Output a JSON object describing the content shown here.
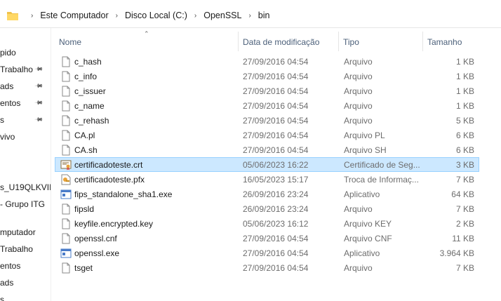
{
  "breadcrumb": [
    "Este Computador",
    "Disco Local (C:)",
    "OpenSSL",
    "bin"
  ],
  "nav": [
    {
      "label": "pido",
      "pinned": false
    },
    {
      "label": "Trabalho",
      "pinned": true
    },
    {
      "label": "ads",
      "pinned": true
    },
    {
      "label": "entos",
      "pinned": true
    },
    {
      "label": "s",
      "pinned": true
    },
    {
      "label": "vivo",
      "pinned": false
    },
    {
      "label": "s_U19QLKVII",
      "pinned": false
    },
    {
      "label": "- Grupo ITG",
      "pinned": false
    },
    {
      "label": "mputador",
      "pinned": false
    },
    {
      "label": "Trabalho",
      "pinned": false
    },
    {
      "label": "entos",
      "pinned": false
    },
    {
      "label": "ads",
      "pinned": false
    },
    {
      "label": "s",
      "pinned": false
    }
  ],
  "columns": {
    "name": "Nome",
    "date": "Data de modificação",
    "type": "Tipo",
    "size": "Tamanho"
  },
  "files": [
    {
      "name": "c_hash",
      "date": "27/09/2016 04:54",
      "type": "Arquivo",
      "size": "1 KB",
      "icon": "file-icon"
    },
    {
      "name": "c_info",
      "date": "27/09/2016 04:54",
      "type": "Arquivo",
      "size": "1 KB",
      "icon": "file-icon"
    },
    {
      "name": "c_issuer",
      "date": "27/09/2016 04:54",
      "type": "Arquivo",
      "size": "1 KB",
      "icon": "file-icon"
    },
    {
      "name": "c_name",
      "date": "27/09/2016 04:54",
      "type": "Arquivo",
      "size": "1 KB",
      "icon": "file-icon"
    },
    {
      "name": "c_rehash",
      "date": "27/09/2016 04:54",
      "type": "Arquivo",
      "size": "5 KB",
      "icon": "file-icon"
    },
    {
      "name": "CA.pl",
      "date": "27/09/2016 04:54",
      "type": "Arquivo PL",
      "size": "6 KB",
      "icon": "file-icon"
    },
    {
      "name": "CA.sh",
      "date": "27/09/2016 04:54",
      "type": "Arquivo SH",
      "size": "6 KB",
      "icon": "file-icon"
    },
    {
      "name": "certificadoteste.crt",
      "date": "05/06/2023 16:22",
      "type": "Certificado de Seg...",
      "size": "3 KB",
      "icon": "certificate-icon",
      "selected": true
    },
    {
      "name": "certificadoteste.pfx",
      "date": "16/05/2023 15:17",
      "type": "Troca de Informaç...",
      "size": "7 KB",
      "icon": "pfx-certificate-icon"
    },
    {
      "name": "fips_standalone_sha1.exe",
      "date": "26/09/2016 23:24",
      "type": "Aplicativo",
      "size": "64 KB",
      "icon": "exe-icon"
    },
    {
      "name": "fipsld",
      "date": "26/09/2016 23:24",
      "type": "Arquivo",
      "size": "7 KB",
      "icon": "file-icon"
    },
    {
      "name": "keyfile.encrypted.key",
      "date": "05/06/2023 16:12",
      "type": "Arquivo KEY",
      "size": "2 KB",
      "icon": "file-icon"
    },
    {
      "name": "openssl.cnf",
      "date": "27/09/2016 04:54",
      "type": "Arquivo CNF",
      "size": "11 KB",
      "icon": "file-icon"
    },
    {
      "name": "openssl.exe",
      "date": "27/09/2016 04:54",
      "type": "Aplicativo",
      "size": "3.964 KB",
      "icon": "exe-icon"
    },
    {
      "name": "tsget",
      "date": "27/09/2016 04:54",
      "type": "Arquivo",
      "size": "7 KB",
      "icon": "file-icon"
    }
  ],
  "colors": {
    "selected_bg": "#cce8ff",
    "selected_border": "#99d1ff",
    "header_text": "#4c607a"
  }
}
